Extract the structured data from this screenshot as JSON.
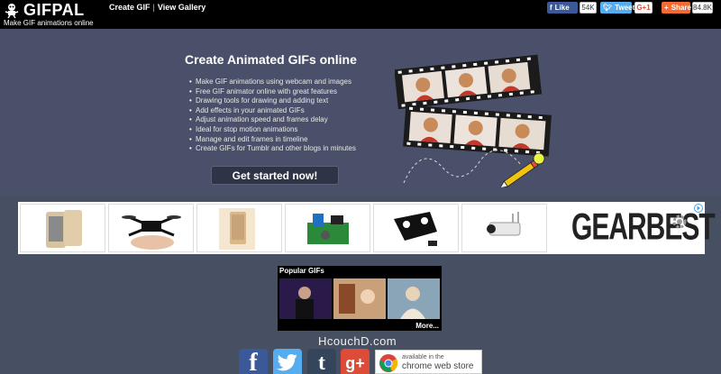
{
  "brand": {
    "name": "GIFPAL",
    "tagline": "Make GIF animations online"
  },
  "nav": {
    "create": "Create GIF",
    "separator": "|",
    "gallery": "View Gallery"
  },
  "social_top": {
    "facebook_label": "Like",
    "facebook_count": "54K",
    "twitter_label": "Tweet",
    "gplus_label": "G+1",
    "share_label": "Share",
    "share_count": "84.8K"
  },
  "hero": {
    "title": "Create Animated GIFs online",
    "features": [
      "Make GIF animations using webcam and images",
      "Free GIF animator online with great features",
      "Drawing tools for drawing and adding text",
      "Add effects in your animated GIFs",
      "Adjust animation speed and frames delay",
      "Ideal for stop motion animations",
      "Manage and edit frames in timeline",
      "Create GIFs for Tumblr and other blogs in minutes"
    ],
    "cta_label": "Get started now!"
  },
  "ads": {
    "brand_text": "GEARBEST"
  },
  "popular": {
    "title": "Popular GIFs",
    "more_label": "More..."
  },
  "watermark": "HcouchD.com",
  "bottom_social": {
    "facebook_glyph": "f",
    "tumblr_glyph": "t",
    "gplus_glyph": "g+",
    "chrome_line1": "available in the",
    "chrome_line2": "chrome web store"
  },
  "colors": {
    "topbar": "#000000",
    "hero_bg": "#4a5069",
    "page_bg": "#475063",
    "facebook": "#3b5998",
    "twitter": "#55acee",
    "gplus": "#dd4b39",
    "share": "#f26a34",
    "tumblr": "#35465c"
  }
}
